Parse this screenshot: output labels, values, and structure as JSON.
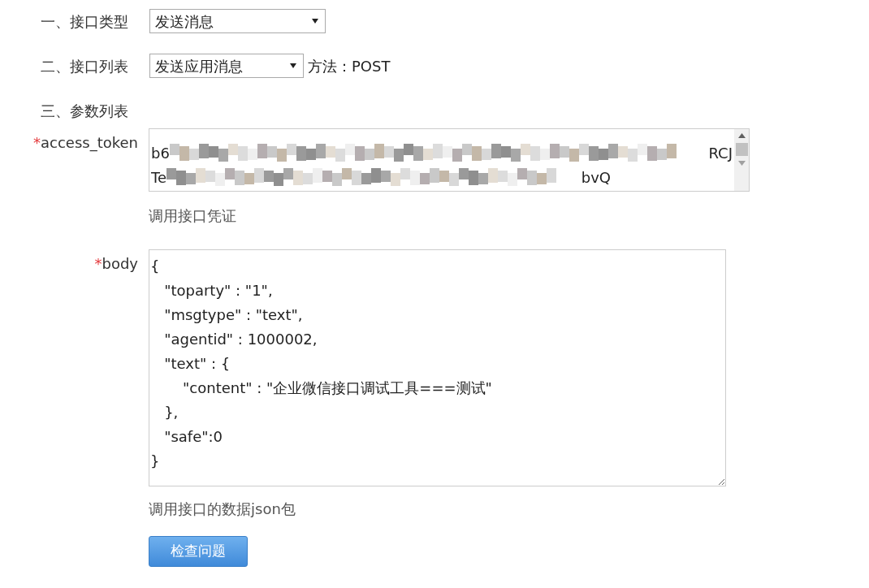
{
  "interface_type": {
    "label": "一、接口类型",
    "value": "发送消息"
  },
  "interface_list": {
    "label": "二、接口列表",
    "value": "发送应用消息",
    "method": "方法：POST"
  },
  "params_heading": "三、参数列表",
  "params": [
    {
      "kind": "token",
      "name": "access_token",
      "required_mark": "*",
      "lines": [
        {
          "start": "b6",
          "end": "RCJ"
        },
        {
          "start": "Te",
          "end": "bvQ"
        }
      ],
      "hint": "调用接口凭证"
    },
    {
      "kind": "body",
      "name": "body",
      "required_mark": "*",
      "value": "{\n   \"toparty\" : \"1\",\n   \"msgtype\" : \"text\",\n   \"agentid\" : 1000002,\n   \"text\" : {\n       \"content\" : \"企业微信接口调试工具===测试\"\n   },\n   \"safe\":0\n}",
      "hint": "调用接口的数据json包"
    }
  ],
  "button": "检查问题"
}
